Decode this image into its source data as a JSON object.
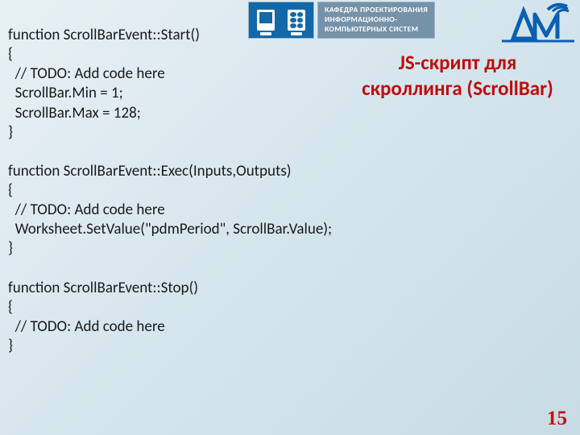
{
  "badge_text": "КАФЕДРА ПРОЕКТИРОВАНИЯ\nИНФОРМАЦИОННО-\nКОМПЬЮТЕРНЫХ СИСТЕМ",
  "title": "JS-скрипт для скроллинга (ScrollBar)",
  "page_number": "15",
  "code": "function ScrollBarEvent::Start()\n{\n  // TODO: Add code here\n  ScrollBar.Min = 1;\n  ScrollBar.Max = 128;\n}\n\nfunction ScrollBarEvent::Exec(Inputs,Outputs)\n{\n  // TODO: Add code here\n  Worksheet.SetValue(\"pdmPeriod\", ScrollBar.Value);\n}\n\nfunction ScrollBarEvent::Stop()\n{\n  // TODO: Add code here\n}"
}
